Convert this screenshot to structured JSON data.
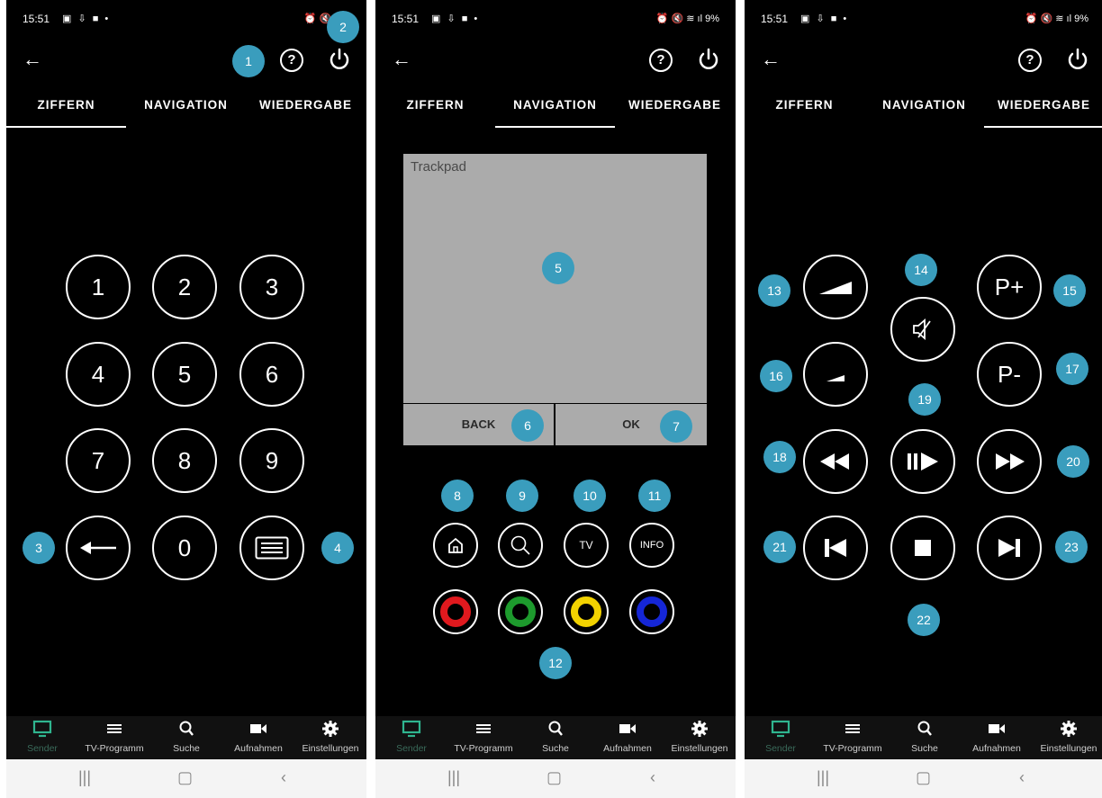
{
  "status": {
    "time": "15:51",
    "battery": "9%"
  },
  "tabs": [
    "ZIFFERN",
    "NAVIGATION",
    "WIEDERGABE"
  ],
  "badges": {
    "b1": "1",
    "b2": "2",
    "b3": "3",
    "b4": "4",
    "b5": "5",
    "b6": "6",
    "b7": "7",
    "b8": "8",
    "b9": "9",
    "b10": "10",
    "b11": "11",
    "b12": "12",
    "b13": "13",
    "b14": "14",
    "b15": "15",
    "b16": "16",
    "b17": "17",
    "b18": "18",
    "b19": "19",
    "b20": "20",
    "b21": "21",
    "b22": "22",
    "b23": "23"
  },
  "digits": [
    "1",
    "2",
    "3",
    "4",
    "5",
    "6",
    "7",
    "8",
    "9",
    "0"
  ],
  "navigation": {
    "trackpad_label": "Trackpad",
    "back_label": "BACK",
    "ok_label": "OK",
    "tv_label": "TV",
    "info_label": "INFO"
  },
  "playback": {
    "p_plus": "P+",
    "p_minus": "P-"
  },
  "bottom_nav": [
    "Sender",
    "TV-Programm",
    "Suche",
    "Aufnahmen",
    "Einstellungen"
  ],
  "colors": {
    "accent_badge": "#3a9dbd",
    "red": "#e0191e",
    "green": "#1d9a2d",
    "yellow": "#f2d200",
    "blue": "#1526d6"
  },
  "icons": [
    "back-arrow-icon",
    "help-icon",
    "power-icon",
    "home-icon",
    "search-icon",
    "tv-icon",
    "mute-icon",
    "rewind-icon",
    "play-pause-icon",
    "fast-forward-icon",
    "skip-back-icon",
    "stop-icon",
    "skip-forward-icon",
    "keyboard-icon",
    "backspace-icon",
    "list-icon",
    "camera-icon",
    "gear-icon"
  ]
}
